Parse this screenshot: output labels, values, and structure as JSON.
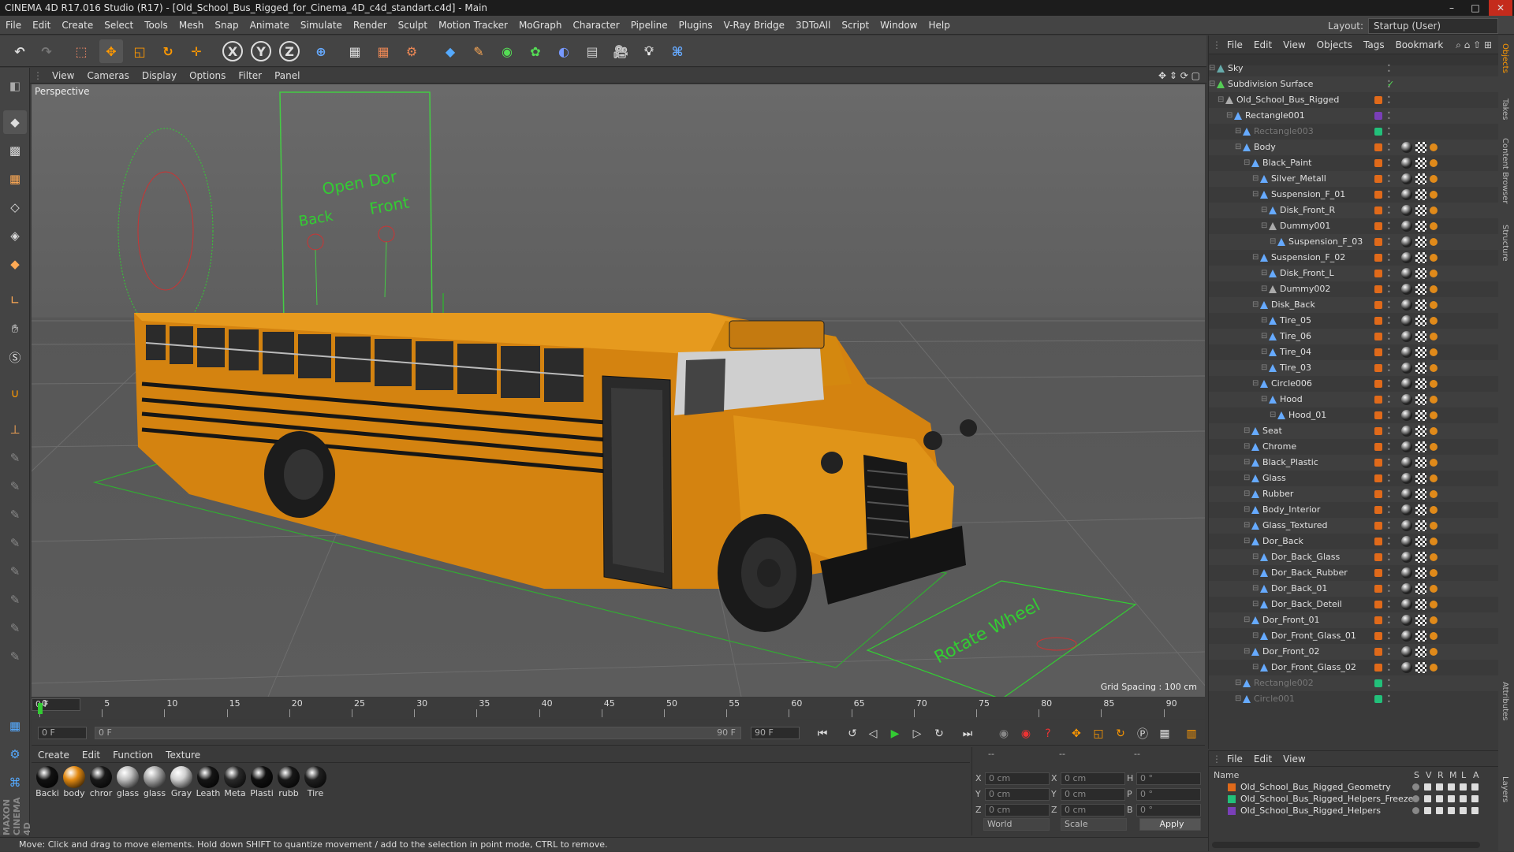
{
  "title": "CINEMA 4D R17.016 Studio (R17) - [Old_School_Bus_Rigged_for_Cinema_4D_c4d_standart.c4d] - Main",
  "menu": [
    "File",
    "Edit",
    "Create",
    "Select",
    "Tools",
    "Mesh",
    "Snap",
    "Animate",
    "Simulate",
    "Render",
    "Sculpt",
    "Motion Tracker",
    "MoGraph",
    "Character",
    "Pipeline",
    "Plugins",
    "V-Ray Bridge",
    "3DToAll",
    "Script",
    "Window",
    "Help"
  ],
  "layout": {
    "label": "Layout:",
    "value": "Startup (User)"
  },
  "viewport": {
    "menu": [
      "View",
      "Cameras",
      "Display",
      "Options",
      "Filter",
      "Panel"
    ],
    "label": "Perspective",
    "grid_spacing": "Grid Spacing : 100 cm",
    "gizmo_text": [
      "Open Dor",
      "Back",
      "Front"
    ],
    "floor_text": "Rotate Wheel"
  },
  "timeline": {
    "ticks": [
      "0",
      "5",
      "10",
      "15",
      "20",
      "25",
      "30",
      "35",
      "40",
      "45",
      "50",
      "55",
      "60",
      "65",
      "70",
      "75",
      "80",
      "85",
      "90"
    ],
    "frame": "0 F"
  },
  "transport": {
    "start": "0 F",
    "slider_start": "0 F",
    "slider_end": "90 F",
    "end": "90 F"
  },
  "materials": {
    "menu": [
      "Create",
      "Edit",
      "Function",
      "Texture"
    ],
    "items": [
      {
        "label": "Backi",
        "color": "#111111"
      },
      {
        "label": "body",
        "color": "#e38a12"
      },
      {
        "label": "chror",
        "color": "#1a1a1a"
      },
      {
        "label": "glass",
        "color": "#bdbdbd"
      },
      {
        "label": "glass",
        "color": "#a8a8a8"
      },
      {
        "label": "Gray",
        "color": "#d0d0d0"
      },
      {
        "label": "Leath",
        "color": "#151515"
      },
      {
        "label": "Meta",
        "color": "#2a2a2a"
      },
      {
        "label": "Plasti",
        "color": "#101010"
      },
      {
        "label": "rubb",
        "color": "#181818"
      },
      {
        "label": "Tire",
        "color": "#202020"
      }
    ]
  },
  "coords": {
    "rows": [
      {
        "a": "X",
        "av": "0 cm",
        "b": "X",
        "bv": "0 cm",
        "c": "H",
        "cv": "0 °"
      },
      {
        "a": "Y",
        "av": "0 cm",
        "b": "Y",
        "bv": "0 cm",
        "c": "P",
        "cv": "0 °"
      },
      {
        "a": "Z",
        "av": "0 cm",
        "b": "Z",
        "bv": "0 cm",
        "c": "B",
        "cv": "0 °"
      }
    ],
    "world": "World",
    "scale": "Scale",
    "apply": "Apply",
    "header": [
      "--",
      "--",
      "--"
    ]
  },
  "objects": {
    "menu": [
      "File",
      "Edit",
      "View",
      "Objects",
      "Tags",
      "Bookmark"
    ],
    "items": [
      {
        "name": "Sky",
        "indent": 0,
        "icon": "#6aa",
        "layer": "",
        "dim": false
      },
      {
        "name": "Subdivision Surface",
        "indent": 0,
        "icon": "#5c5",
        "layer": "",
        "dim": false
      },
      {
        "name": "Old_School_Bus_Rigged",
        "indent": 1,
        "icon": "#aaa",
        "layer": "#e06a1a",
        "dim": false
      },
      {
        "name": "Rectangle001",
        "indent": 2,
        "icon": "#6af",
        "layer": "#7a3fb8",
        "dim": false
      },
      {
        "name": "Rectangle003",
        "indent": 3,
        "icon": "#6af",
        "layer": "#22c07a",
        "dim": true
      },
      {
        "name": "Body",
        "indent": 3,
        "icon": "#6af",
        "layer": "#e06a1a",
        "dim": false
      },
      {
        "name": "Black_Paint",
        "indent": 4,
        "icon": "#6af",
        "layer": "#e06a1a",
        "dim": false
      },
      {
        "name": "Silver_Metall",
        "indent": 5,
        "icon": "#6af",
        "layer": "#e06a1a",
        "dim": false
      },
      {
        "name": "Suspension_F_01",
        "indent": 5,
        "icon": "#6af",
        "layer": "#e06a1a",
        "dim": false
      },
      {
        "name": "Disk_Front_R",
        "indent": 6,
        "icon": "#6af",
        "layer": "#e06a1a",
        "dim": false
      },
      {
        "name": "Dummy001",
        "indent": 6,
        "icon": "#aaa",
        "layer": "#e06a1a",
        "dim": false
      },
      {
        "name": "Suspension_F_03",
        "indent": 7,
        "icon": "#6af",
        "layer": "#e06a1a",
        "dim": false
      },
      {
        "name": "Suspension_F_02",
        "indent": 5,
        "icon": "#6af",
        "layer": "#e06a1a",
        "dim": false
      },
      {
        "name": "Disk_Front_L",
        "indent": 6,
        "icon": "#6af",
        "layer": "#e06a1a",
        "dim": false
      },
      {
        "name": "Dummy002",
        "indent": 6,
        "icon": "#aaa",
        "layer": "#e06a1a",
        "dim": false
      },
      {
        "name": "Disk_Back",
        "indent": 5,
        "icon": "#6af",
        "layer": "#e06a1a",
        "dim": false
      },
      {
        "name": "Tire_05",
        "indent": 6,
        "icon": "#6af",
        "layer": "#e06a1a",
        "dim": false
      },
      {
        "name": "Tire_06",
        "indent": 6,
        "icon": "#6af",
        "layer": "#e06a1a",
        "dim": false
      },
      {
        "name": "Tire_04",
        "indent": 6,
        "icon": "#6af",
        "layer": "#e06a1a",
        "dim": false
      },
      {
        "name": "Tire_03",
        "indent": 6,
        "icon": "#6af",
        "layer": "#e06a1a",
        "dim": false
      },
      {
        "name": "Circle006",
        "indent": 5,
        "icon": "#6af",
        "layer": "#e06a1a",
        "dim": false
      },
      {
        "name": "Hood",
        "indent": 6,
        "icon": "#6af",
        "layer": "#e06a1a",
        "dim": false
      },
      {
        "name": "Hood_01",
        "indent": 7,
        "icon": "#6af",
        "layer": "#e06a1a",
        "dim": false
      },
      {
        "name": "Seat",
        "indent": 4,
        "icon": "#6af",
        "layer": "#e06a1a",
        "dim": false
      },
      {
        "name": "Chrome",
        "indent": 4,
        "icon": "#6af",
        "layer": "#e06a1a",
        "dim": false
      },
      {
        "name": "Black_Plastic",
        "indent": 4,
        "icon": "#6af",
        "layer": "#e06a1a",
        "dim": false
      },
      {
        "name": "Glass",
        "indent": 4,
        "icon": "#6af",
        "layer": "#e06a1a",
        "dim": false
      },
      {
        "name": "Rubber",
        "indent": 4,
        "icon": "#6af",
        "layer": "#e06a1a",
        "dim": false
      },
      {
        "name": "Body_Interior",
        "indent": 4,
        "icon": "#6af",
        "layer": "#e06a1a",
        "dim": false
      },
      {
        "name": "Glass_Textured",
        "indent": 4,
        "icon": "#6af",
        "layer": "#e06a1a",
        "dim": false
      },
      {
        "name": "Dor_Back",
        "indent": 4,
        "icon": "#6af",
        "layer": "#e06a1a",
        "dim": false
      },
      {
        "name": "Dor_Back_Glass",
        "indent": 5,
        "icon": "#6af",
        "layer": "#e06a1a",
        "dim": false
      },
      {
        "name": "Dor_Back_Rubber",
        "indent": 5,
        "icon": "#6af",
        "layer": "#e06a1a",
        "dim": false
      },
      {
        "name": "Dor_Back_01",
        "indent": 5,
        "icon": "#6af",
        "layer": "#e06a1a",
        "dim": false
      },
      {
        "name": "Dor_Back_Deteil",
        "indent": 5,
        "icon": "#6af",
        "layer": "#e06a1a",
        "dim": false
      },
      {
        "name": "Dor_Front_01",
        "indent": 4,
        "icon": "#6af",
        "layer": "#e06a1a",
        "dim": false
      },
      {
        "name": "Dor_Front_Glass_01",
        "indent": 5,
        "icon": "#6af",
        "layer": "#e06a1a",
        "dim": false
      },
      {
        "name": "Dor_Front_02",
        "indent": 4,
        "icon": "#6af",
        "layer": "#e06a1a",
        "dim": false
      },
      {
        "name": "Dor_Front_Glass_02",
        "indent": 5,
        "icon": "#6af",
        "layer": "#e06a1a",
        "dim": false
      },
      {
        "name": "Rectangle002",
        "indent": 3,
        "icon": "#6af",
        "layer": "#22c07a",
        "dim": true
      },
      {
        "name": "Circle001",
        "indent": 3,
        "icon": "#6af",
        "layer": "#22c07a",
        "dim": true
      }
    ]
  },
  "layers": {
    "menu": [
      "File",
      "Edit",
      "View"
    ],
    "header": {
      "name": "Name",
      "cols": [
        "S",
        "V",
        "R",
        "M",
        "L",
        "A"
      ]
    },
    "items": [
      {
        "name": "Old_School_Bus_Rigged_Geometry",
        "color": "#e06a1a"
      },
      {
        "name": "Old_School_Bus_Rigged_Helpers_Freeze",
        "color": "#22c07a"
      },
      {
        "name": "Old_School_Bus_Rigged_Helpers",
        "color": "#7a3fb8"
      }
    ]
  },
  "right_tabs": [
    "Objects",
    "Takes",
    "Content Browser",
    "Structure",
    "Attributes",
    "Layers"
  ],
  "status": "Move: Click and drag to move elements. Hold down SHIFT to quantize movement / add to the selection in point mode, CTRL to remove."
}
